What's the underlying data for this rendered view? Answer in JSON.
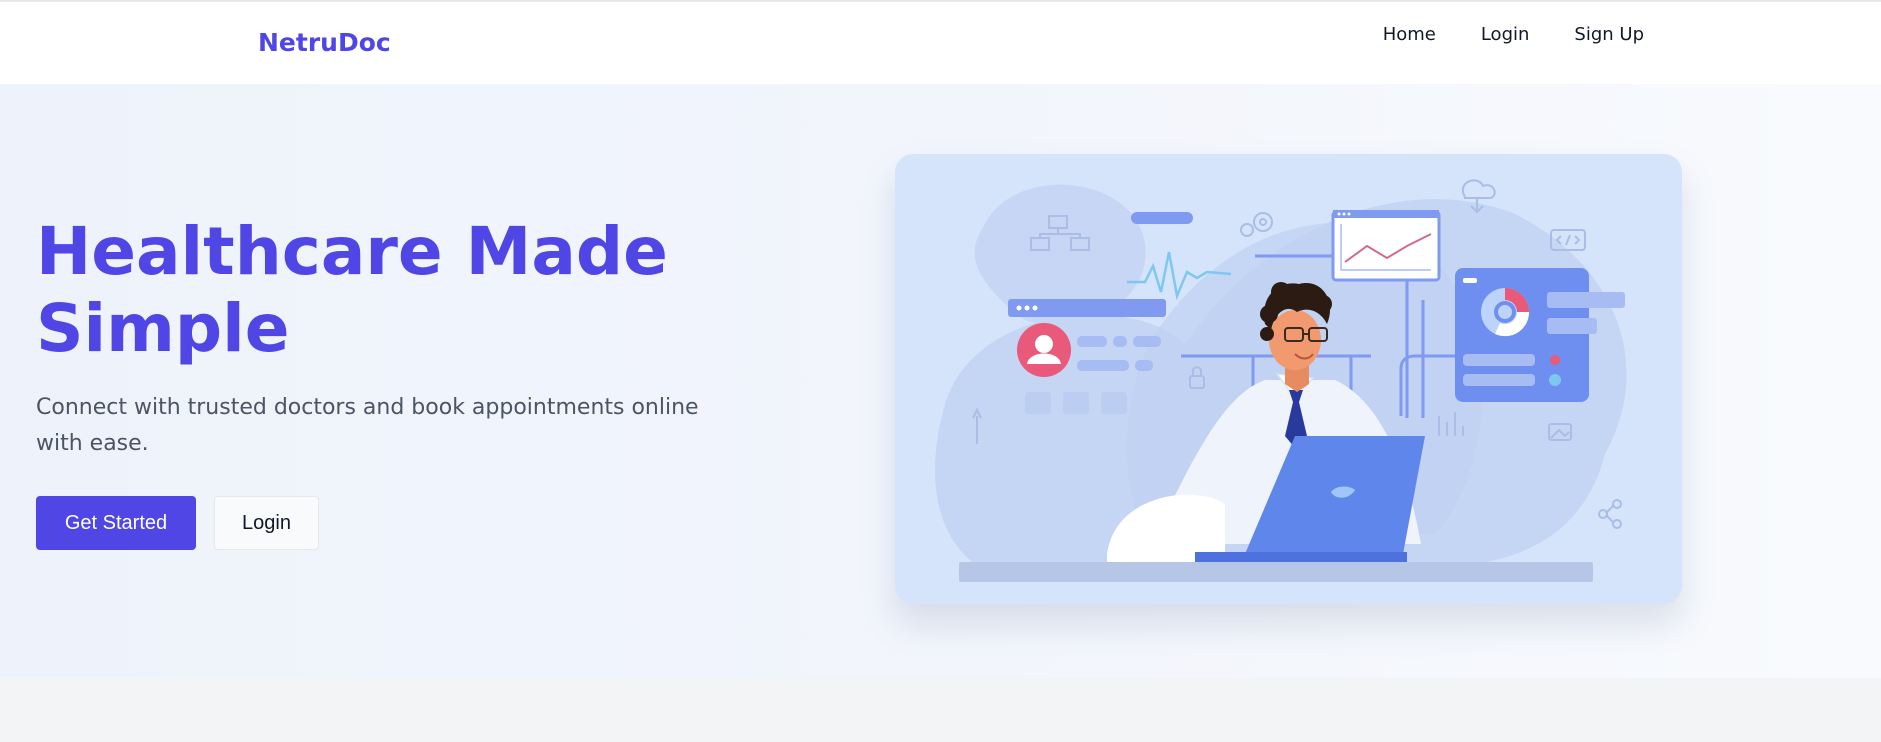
{
  "brand": {
    "name": "NetruDoc"
  },
  "nav": {
    "items": [
      {
        "label": "Home"
      },
      {
        "label": "Login"
      },
      {
        "label": "Sign Up"
      }
    ]
  },
  "hero": {
    "title_line1": "Healthcare Made",
    "title_line2": "Simple",
    "subtitle": "Connect with trusted doctors and book appointments online with ease.",
    "primary_button": "Get Started",
    "secondary_button": "Login"
  },
  "colors": {
    "brand": "#4f46e5",
    "hero_bg": "#eef3fb",
    "illustration_bg": "#d6e4fb",
    "accent_pink": "#e8597a",
    "accent_blue": "#6f8ff0"
  },
  "icons": [
    "doctor-laptop-illustration",
    "profile-card-icon",
    "line-chart-icon",
    "donut-chart-icon",
    "cloud-download-icon",
    "code-icon",
    "lock-icon",
    "gear-icon"
  ]
}
